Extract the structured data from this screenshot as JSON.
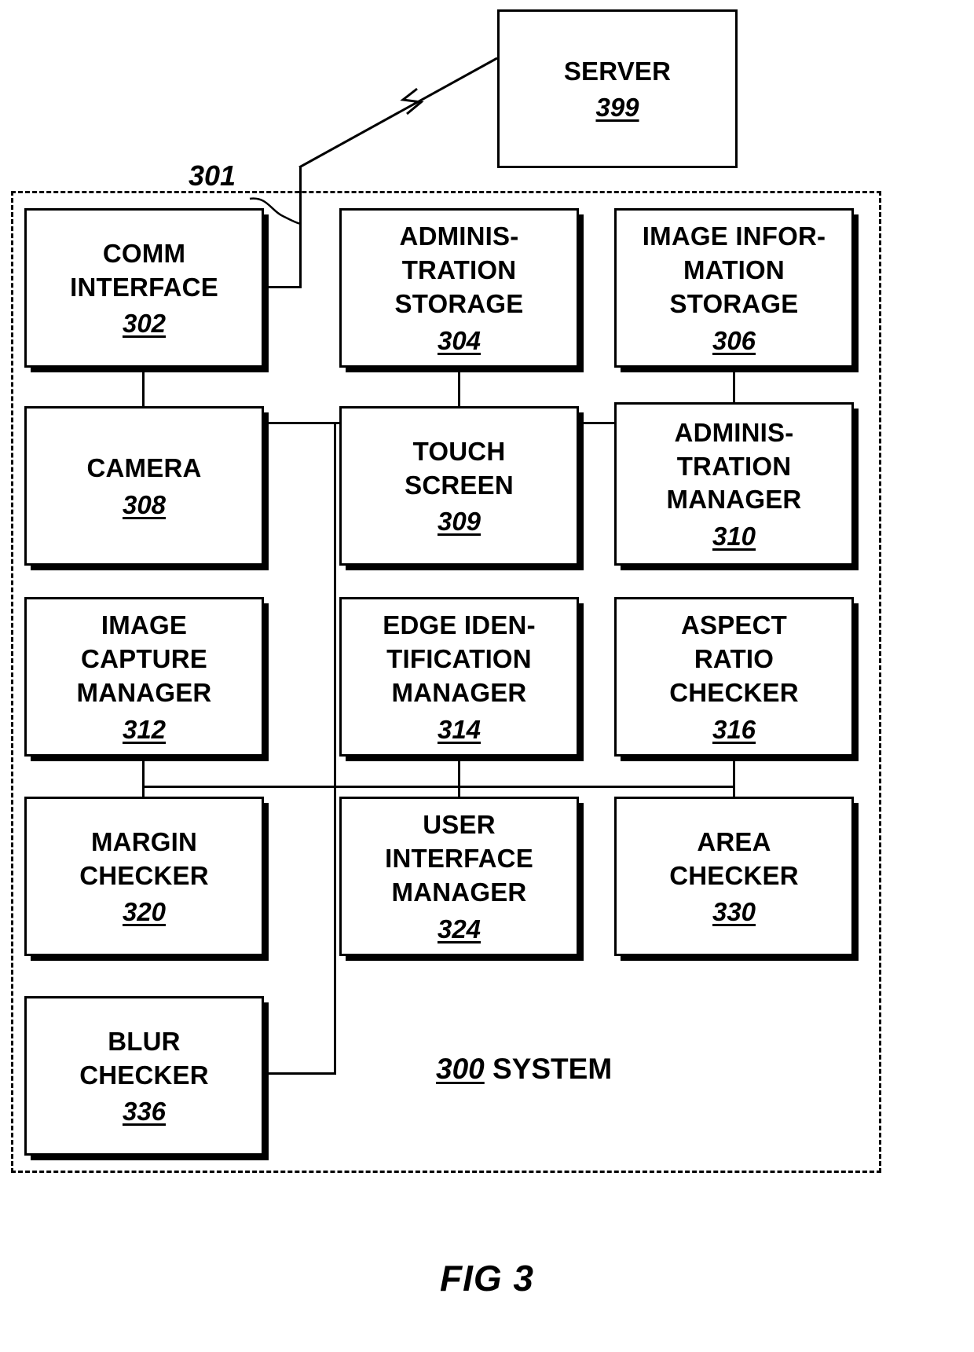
{
  "figure": {
    "caption": "FIG 3",
    "system_ref": "300",
    "system_label": " SYSTEM",
    "boundary_ref": "301"
  },
  "nodes": {
    "server": {
      "title": "SERVER",
      "ref": "399"
    },
    "comm": {
      "title": "COMM\nINTERFACE",
      "ref": "302"
    },
    "admin_storage": {
      "title": "ADMINIS-\nTRATION\nSTORAGE",
      "ref": "304"
    },
    "image_storage": {
      "title": "IMAGE INFOR-\nMATION\nSTORAGE",
      "ref": "306"
    },
    "camera": {
      "title": "CAMERA",
      "ref": "308"
    },
    "touch_screen": {
      "title": "TOUCH\nSCREEN",
      "ref": "309"
    },
    "admin_manager": {
      "title": "ADMINIS-\nTRATION\nMANAGER",
      "ref": "310"
    },
    "capture_mgr": {
      "title": "IMAGE\nCAPTURE\nMANAGER",
      "ref": "312"
    },
    "edge_mgr": {
      "title": "EDGE IDEN-\nTIFICATION\nMANAGER",
      "ref": "314"
    },
    "aspect_ratio": {
      "title": "ASPECT\nRATIO\nCHECKER",
      "ref": "316"
    },
    "margin": {
      "title": "MARGIN\nCHECKER",
      "ref": "320"
    },
    "ui_manager": {
      "title": "USER\nINTERFACE\nMANAGER",
      "ref": "324"
    },
    "area": {
      "title": "AREA\nCHECKER",
      "ref": "330"
    },
    "blur": {
      "title": "BLUR\nCHECKER",
      "ref": "336"
    }
  },
  "colors": {
    "stroke": "#000000",
    "background": "#ffffff"
  }
}
